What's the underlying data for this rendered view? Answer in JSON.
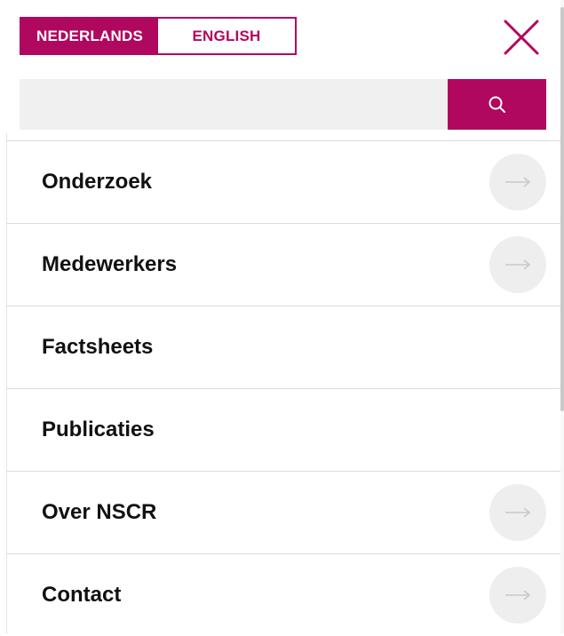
{
  "language": {
    "options": [
      {
        "label": "NEDERLANDS",
        "active": true
      },
      {
        "label": "ENGLISH",
        "active": false
      }
    ]
  },
  "close": {
    "icon": "close-icon"
  },
  "search": {
    "value": "",
    "placeholder": "",
    "button_icon": "search-icon"
  },
  "nav": {
    "items": [
      {
        "label": "Onderzoek",
        "has_submenu": true,
        "icon": "arrow-right-icon"
      },
      {
        "label": "Medewerkers",
        "has_submenu": true,
        "icon": "arrow-right-icon"
      },
      {
        "label": "Factsheets",
        "has_submenu": false
      },
      {
        "label": "Publicaties",
        "has_submenu": false
      },
      {
        "label": "Over NSCR",
        "has_submenu": true,
        "icon": "arrow-right-icon"
      },
      {
        "label": "Contact",
        "has_submenu": true,
        "icon": "arrow-right-icon"
      }
    ]
  },
  "colors": {
    "accent": "#b0085e",
    "search_bg": "#f0f0f0",
    "arrow_circle_bg": "#eeeeee",
    "arrow_color": "#c9c9c9",
    "divider": "#dcdcdc",
    "text": "#111111"
  }
}
